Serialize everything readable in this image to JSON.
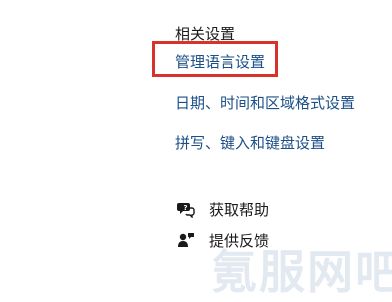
{
  "related_settings": {
    "title": "相关设置",
    "links": {
      "language": "管理语言设置",
      "date_time_region": "日期、时间和区域格式设置",
      "spelling_typing_keyboard": "拼写、键入和键盘设置"
    }
  },
  "help": {
    "get_help": {
      "label": "获取帮助",
      "icon": "help-chat-icon"
    },
    "feedback": {
      "label": "提供反馈",
      "icon": "feedback-person-icon"
    }
  },
  "watermark": {
    "text": "氪服网吧"
  },
  "colors": {
    "link": "#1c4f87",
    "highlight": "#d8322c",
    "text": "#1a1a1a"
  }
}
